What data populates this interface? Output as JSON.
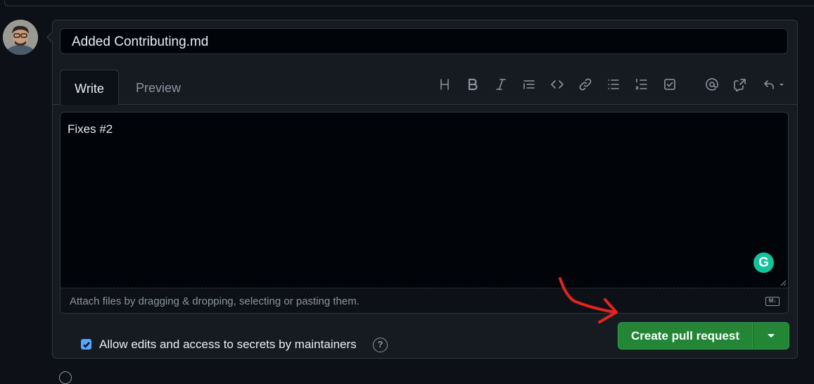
{
  "title_input": {
    "value": "Added Contributing.md"
  },
  "tabs": [
    {
      "label": "Write"
    },
    {
      "label": "Preview"
    }
  ],
  "toolbar": {
    "icons": [
      "heading-icon",
      "bold-icon",
      "italic-icon",
      "quote-icon",
      "code-icon",
      "link-icon",
      "unordered-list-icon",
      "ordered-list-icon",
      "task-list-icon",
      "mention-icon",
      "reference-icon",
      "reply-icon"
    ]
  },
  "editor": {
    "text": "Fixes #2",
    "attach_hint": "Attach files by dragging & dropping, selecting or pasting them.",
    "markdown_badge": "M↓"
  },
  "grammarly": {
    "glyph": "G",
    "color": "#15c39a"
  },
  "maintainer_edits": {
    "label": "Allow edits and access to secrets by maintainers",
    "checked": true,
    "help_glyph": "?"
  },
  "create_button": {
    "label": "Create pull request",
    "color": "#238636"
  },
  "colors": {
    "background": "#0d1117",
    "panel": "#161b22",
    "border": "#30363d",
    "annotation": "#e5231b"
  }
}
